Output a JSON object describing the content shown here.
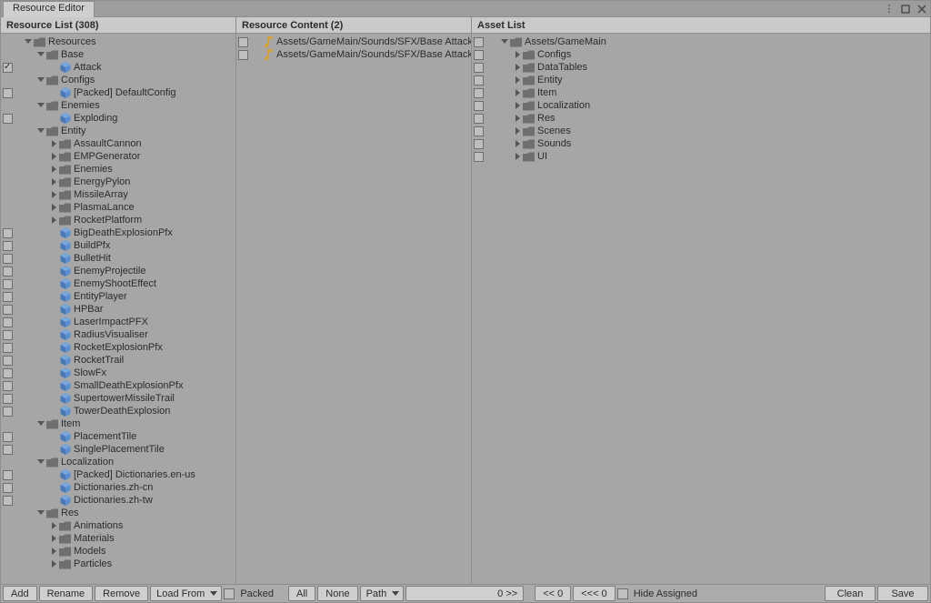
{
  "window": {
    "title": "Resource Editor"
  },
  "headers": {
    "list": "Resource List (308)",
    "content": "Resource Content (2)",
    "asset": "Asset List"
  },
  "toolbar": {
    "add": "Add",
    "rename": "Rename",
    "remove": "Remove",
    "load_from": "Load From",
    "packed": "Packed",
    "all": "All",
    "none": "None",
    "path": "Path",
    "count": "0 >>",
    "back": "<< 0",
    "backall": "<<< 0",
    "hide": "Hide Assigned",
    "clean": "Clean",
    "save": "Save"
  },
  "resource_list": [
    {
      "d": 0,
      "a": "d",
      "t": "folder",
      "n": "Resources",
      "chk": null
    },
    {
      "d": 1,
      "a": "d",
      "t": "folder",
      "n": "Base",
      "chk": null
    },
    {
      "d": 2,
      "a": "",
      "t": "cube",
      "n": "Attack",
      "chk": "on"
    },
    {
      "d": 1,
      "a": "d",
      "t": "folder",
      "n": "Configs",
      "chk": null
    },
    {
      "d": 2,
      "a": "",
      "t": "cube",
      "n": "[Packed] DefaultConfig",
      "chk": ""
    },
    {
      "d": 1,
      "a": "d",
      "t": "folder",
      "n": "Enemies",
      "chk": null
    },
    {
      "d": 2,
      "a": "",
      "t": "cube",
      "n": "Exploding",
      "chk": ""
    },
    {
      "d": 1,
      "a": "d",
      "t": "folder",
      "n": "Entity",
      "chk": null
    },
    {
      "d": 2,
      "a": "r",
      "t": "folder",
      "n": "AssaultCannon",
      "chk": null
    },
    {
      "d": 2,
      "a": "r",
      "t": "folder",
      "n": "EMPGenerator",
      "chk": null
    },
    {
      "d": 2,
      "a": "r",
      "t": "folder",
      "n": "Enemies",
      "chk": null
    },
    {
      "d": 2,
      "a": "r",
      "t": "folder",
      "n": "EnergyPylon",
      "chk": null
    },
    {
      "d": 2,
      "a": "r",
      "t": "folder",
      "n": "MissileArray",
      "chk": null
    },
    {
      "d": 2,
      "a": "r",
      "t": "folder",
      "n": "PlasmaLance",
      "chk": null
    },
    {
      "d": 2,
      "a": "r",
      "t": "folder",
      "n": "RocketPlatform",
      "chk": null
    },
    {
      "d": 2,
      "a": "",
      "t": "cube",
      "n": "BigDeathExplosionPfx",
      "chk": ""
    },
    {
      "d": 2,
      "a": "",
      "t": "cube",
      "n": "BuildPfx",
      "chk": ""
    },
    {
      "d": 2,
      "a": "",
      "t": "cube",
      "n": "BulletHit",
      "chk": ""
    },
    {
      "d": 2,
      "a": "",
      "t": "cube",
      "n": "EnemyProjectile",
      "chk": ""
    },
    {
      "d": 2,
      "a": "",
      "t": "cube",
      "n": "EnemyShootEffect",
      "chk": ""
    },
    {
      "d": 2,
      "a": "",
      "t": "cube",
      "n": "EntityPlayer",
      "chk": ""
    },
    {
      "d": 2,
      "a": "",
      "t": "cube",
      "n": "HPBar",
      "chk": ""
    },
    {
      "d": 2,
      "a": "",
      "t": "cube",
      "n": "LaserImpactPFX",
      "chk": ""
    },
    {
      "d": 2,
      "a": "",
      "t": "cube",
      "n": "RadiusVisualiser",
      "chk": ""
    },
    {
      "d": 2,
      "a": "",
      "t": "cube",
      "n": "RocketExplosionPfx",
      "chk": ""
    },
    {
      "d": 2,
      "a": "",
      "t": "cube",
      "n": "RocketTrail",
      "chk": ""
    },
    {
      "d": 2,
      "a": "",
      "t": "cube",
      "n": "SlowFx",
      "chk": ""
    },
    {
      "d": 2,
      "a": "",
      "t": "cube",
      "n": "SmallDeathExplosionPfx",
      "chk": ""
    },
    {
      "d": 2,
      "a": "",
      "t": "cube",
      "n": "SupertowerMissileTrail",
      "chk": ""
    },
    {
      "d": 2,
      "a": "",
      "t": "cube",
      "n": "TowerDeathExplosion",
      "chk": ""
    },
    {
      "d": 1,
      "a": "d",
      "t": "folder",
      "n": "Item",
      "chk": null
    },
    {
      "d": 2,
      "a": "",
      "t": "cube",
      "n": "PlacementTile",
      "chk": ""
    },
    {
      "d": 2,
      "a": "",
      "t": "cube",
      "n": "SinglePlacementTile",
      "chk": ""
    },
    {
      "d": 1,
      "a": "d",
      "t": "folder",
      "n": "Localization",
      "chk": null
    },
    {
      "d": 2,
      "a": "",
      "t": "cube",
      "n": "[Packed] Dictionaries.en-us",
      "chk": ""
    },
    {
      "d": 2,
      "a": "",
      "t": "cube",
      "n": "Dictionaries.zh-cn",
      "chk": ""
    },
    {
      "d": 2,
      "a": "",
      "t": "cube",
      "n": "Dictionaries.zh-tw",
      "chk": ""
    },
    {
      "d": 1,
      "a": "d",
      "t": "folder",
      "n": "Res",
      "chk": null
    },
    {
      "d": 2,
      "a": "r",
      "t": "folder",
      "n": "Animations",
      "chk": null
    },
    {
      "d": 2,
      "a": "r",
      "t": "folder",
      "n": "Materials",
      "chk": null
    },
    {
      "d": 2,
      "a": "r",
      "t": "folder",
      "n": "Models",
      "chk": null
    },
    {
      "d": 2,
      "a": "r",
      "t": "folder",
      "n": "Particles",
      "chk": null
    }
  ],
  "content_list": [
    {
      "d": 0,
      "a": "",
      "t": "audio",
      "n": "Assets/GameMain/Sounds/SFX/Base Attack/base_atta",
      "chk": ""
    },
    {
      "d": 0,
      "a": "",
      "t": "audio",
      "n": "Assets/GameMain/Sounds/SFX/Base Attack/zone_ent",
      "chk": ""
    }
  ],
  "asset_list": [
    {
      "d": 0,
      "a": "d",
      "t": "folder",
      "n": "Assets/GameMain",
      "chk": ""
    },
    {
      "d": 1,
      "a": "r",
      "t": "folder",
      "n": "Configs",
      "chk": ""
    },
    {
      "d": 1,
      "a": "r",
      "t": "folder",
      "n": "DataTables",
      "chk": ""
    },
    {
      "d": 1,
      "a": "r",
      "t": "folder",
      "n": "Entity",
      "chk": ""
    },
    {
      "d": 1,
      "a": "r",
      "t": "folder",
      "n": "Item",
      "chk": ""
    },
    {
      "d": 1,
      "a": "r",
      "t": "folder",
      "n": "Localization",
      "chk": ""
    },
    {
      "d": 1,
      "a": "r",
      "t": "folder",
      "n": "Res",
      "chk": ""
    },
    {
      "d": 1,
      "a": "r",
      "t": "folder",
      "n": "Scenes",
      "chk": ""
    },
    {
      "d": 1,
      "a": "r",
      "t": "folder",
      "n": "Sounds",
      "chk": ""
    },
    {
      "d": 1,
      "a": "r",
      "t": "folder",
      "n": "UI",
      "chk": ""
    }
  ],
  "icons": {
    "folder": "folder-icon",
    "cube": "prefab-icon",
    "audio": "audio-icon"
  }
}
